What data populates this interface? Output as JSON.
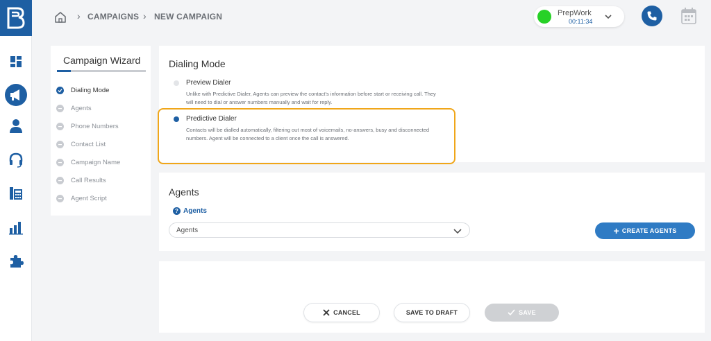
{
  "header": {
    "breadcrumbs": [
      "CAMPAIGNS",
      "NEW CAMPAIGN"
    ],
    "status": {
      "name": "PrepWork",
      "timer": "00:11:34",
      "color": "#27d127"
    }
  },
  "sidebar": {
    "icons": [
      "dashboard-icon",
      "megaphone-icon",
      "user-icon",
      "headset-icon",
      "phonebook-icon",
      "bar-chart-icon",
      "puzzle-icon"
    ]
  },
  "wizard": {
    "title": "Campaign Wizard",
    "progress_fraction": 0.16,
    "steps": [
      {
        "label": "Dialing Mode",
        "active": true
      },
      {
        "label": "Agents",
        "active": false
      },
      {
        "label": "Phone Numbers",
        "active": false
      },
      {
        "label": "Contact List",
        "active": false
      },
      {
        "label": "Campaign Name",
        "active": false
      },
      {
        "label": "Call Results",
        "active": false
      },
      {
        "label": "Agent Script",
        "active": false
      }
    ]
  },
  "dialing_mode": {
    "title": "Dialing Mode",
    "options": [
      {
        "label": "Preview Dialer",
        "description": "Unlike with Predictive Dialer, Agents can preview the contact's information before start or receiving call. They will need to dial or answer numbers manually and wait for reply.",
        "selected": false
      },
      {
        "label": "Predictive Dialer",
        "description": "Contacts will be dialled automatically, filtering out most of voicemails, no-answers, busy and disconnected numbers. Agent will be connected to a client once the call is answered.",
        "selected": true
      }
    ]
  },
  "agents": {
    "title": "Agents",
    "field_label": "Agents",
    "select_value": "Agents",
    "create_button": "CREATE AGENTS"
  },
  "actions": {
    "cancel": "CANCEL",
    "save_draft": "SAVE TO DRAFT",
    "save": "SAVE"
  },
  "colors": {
    "brand": "#1e5fa3",
    "highlight": "#f0a619",
    "status_online": "#27d127"
  }
}
